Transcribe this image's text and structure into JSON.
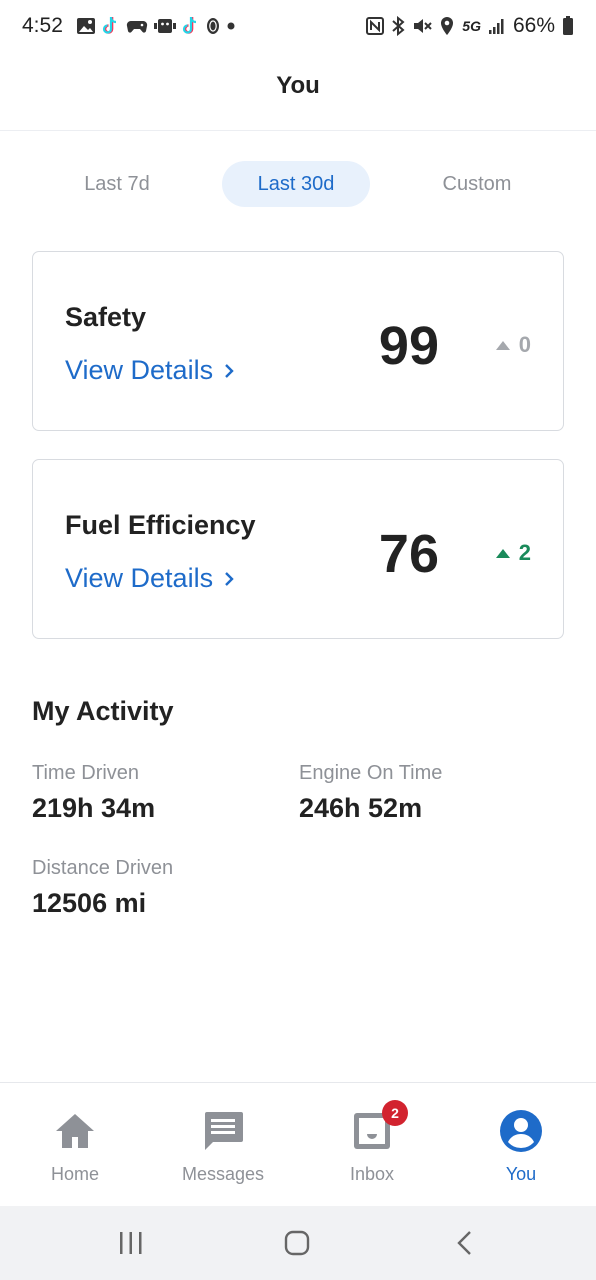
{
  "status_bar": {
    "time": "4:52",
    "network": "5G",
    "battery": "66%",
    "left_icons": [
      "gallery-icon",
      "tiktok-icon",
      "game-controller-icon",
      "robot-icon",
      "tiktok-icon",
      "fingerprint-icon",
      "dot-icon"
    ],
    "right_icons": [
      "nfc-icon",
      "bluetooth-icon",
      "mute-icon",
      "location-icon",
      "signal-icon",
      "battery-icon"
    ]
  },
  "header": {
    "title": "You"
  },
  "periods": {
    "tabs": [
      {
        "label": "Last 7d",
        "active": false
      },
      {
        "label": "Last 30d",
        "active": true
      },
      {
        "label": "Custom",
        "active": false
      }
    ]
  },
  "scores": [
    {
      "title": "Safety",
      "link": "View Details",
      "score": "99",
      "delta": "0",
      "delta_direction": "up",
      "delta_color": "#a5a8ad"
    },
    {
      "title": "Fuel Efficiency",
      "link": "View Details",
      "score": "76",
      "delta": "2",
      "delta_direction": "up",
      "delta_color": "#1a8a5a"
    }
  ],
  "activity": {
    "title": "My Activity",
    "stats": [
      {
        "label": "Time Driven",
        "value": "219h 34m"
      },
      {
        "label": "Engine On Time",
        "value": "246h 52m"
      },
      {
        "label": "Distance Driven",
        "value": "12506 mi"
      }
    ]
  },
  "bottom_nav": {
    "items": [
      {
        "label": "Home",
        "icon": "home-icon",
        "active": false
      },
      {
        "label": "Messages",
        "icon": "messages-icon",
        "active": false
      },
      {
        "label": "Inbox",
        "icon": "inbox-icon",
        "active": false,
        "badge": "2"
      },
      {
        "label": "You",
        "icon": "account-icon",
        "active": true
      }
    ]
  },
  "colors": {
    "accent": "#1e6bc9",
    "accent_light": "#e8f1fc",
    "positive": "#1a8a5a",
    "muted": "#8e9197",
    "badge": "#d2232f"
  }
}
